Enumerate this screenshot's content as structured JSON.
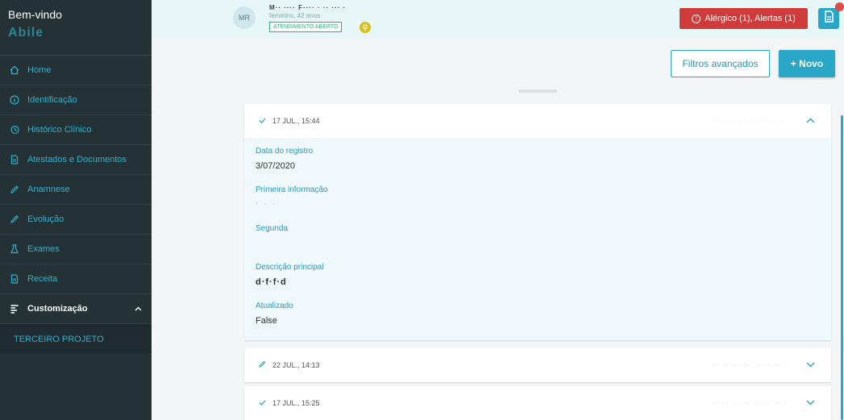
{
  "sidebar": {
    "welcome": "Bem-vindo",
    "username": "Abile",
    "items": [
      {
        "label": "Home",
        "icon": "home-icon"
      },
      {
        "label": "Identificação",
        "icon": "info-icon"
      },
      {
        "label": "Histórico Clínico",
        "icon": "history-icon"
      },
      {
        "label": "Atestados e Documentos",
        "icon": "document-icon"
      },
      {
        "label": "Anamnese",
        "icon": "pencil-icon"
      },
      {
        "label": "Evolução",
        "icon": "pencil-icon"
      },
      {
        "label": "Exames",
        "icon": "flask-icon"
      },
      {
        "label": "Receita",
        "icon": "document-icon"
      }
    ],
    "expanded": {
      "label": "Customização",
      "icon": "form-icon"
    },
    "subitem": "TERCEIRO PROJETO"
  },
  "topbar": {
    "avatar": "MR",
    "patient_name": "M·· ···· F···· · ·· ··· ·",
    "patient_info": "feminino, 42 anos",
    "status": "ATENDIMENTO ABERTO",
    "alert_text": "Alérgico (1),  Alertas (1)"
  },
  "toolbar": {
    "filter_label": "Filtros avançados",
    "new_label": "+ Novo"
  },
  "records": [
    {
      "date": "17 JUL., 15:44",
      "status_icon": "check-icon",
      "author": "·· · ·· ·· ·· ·· ·· ··",
      "expanded": true
    },
    {
      "date": "22 JUL., 14:13",
      "status_icon": "pencil-icon",
      "author": "·· ·· ·· ·· ·· ·· ·· ·",
      "expanded": false
    },
    {
      "date": "17 JUL., 15:25",
      "status_icon": "check-icon",
      "author": "·· ·· ·· ·· ·· ·· ·· ·",
      "expanded": false
    }
  ],
  "record_detail": {
    "fields": [
      {
        "label": "Data do registro",
        "value": "3/07/2020"
      },
      {
        "label": "Primeira informação",
        "value": "· ·  ·"
      },
      {
        "label": "Segunda",
        "value": ""
      },
      {
        "label": "Descrição principal",
        "value": "d·f·f·d"
      },
      {
        "label": "Atualizado",
        "value": "False"
      }
    ]
  },
  "colors": {
    "accent": "#2aa6c6",
    "sidebar_bg": "#253235",
    "alert_red": "#cf3b3b",
    "badge_green": "#2fb07d"
  }
}
